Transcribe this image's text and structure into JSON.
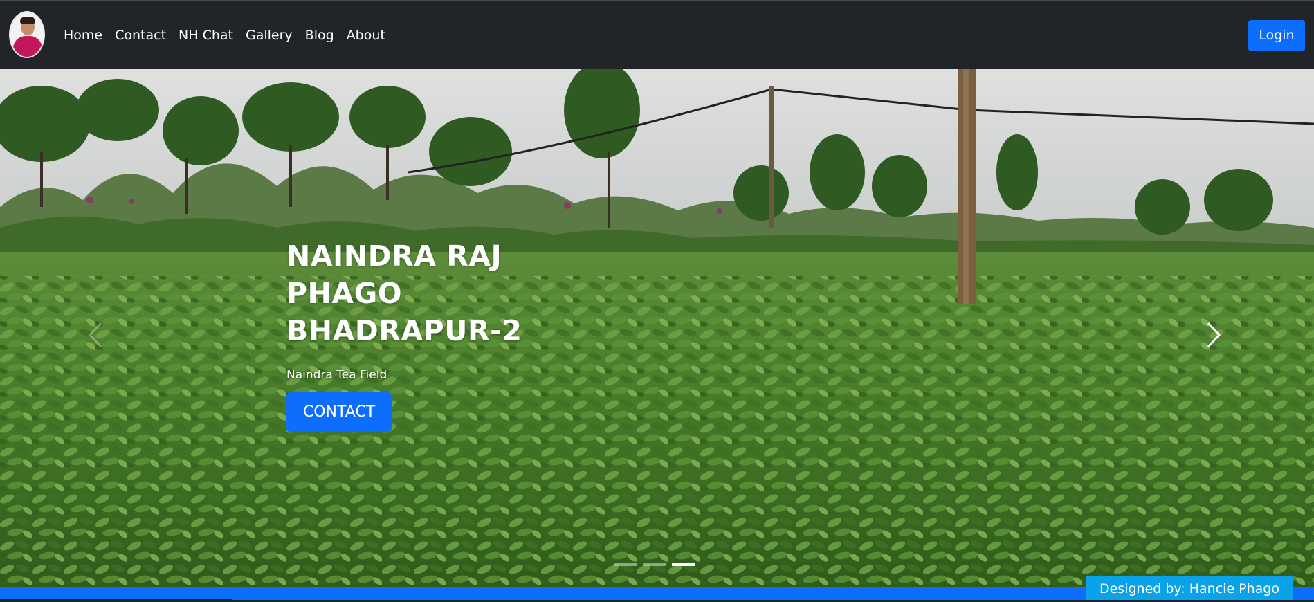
{
  "navbar": {
    "avatar_alt": "profile photo",
    "links": [
      {
        "label": "Home"
      },
      {
        "label": "Contact"
      },
      {
        "label": "NH Chat"
      },
      {
        "label": "Gallery"
      },
      {
        "label": "Blog"
      },
      {
        "label": "About"
      }
    ],
    "login_label": "Login"
  },
  "hero": {
    "title_lines": [
      "NAINDRA RAJ",
      "PHAGO",
      "BHADRAPUR-2"
    ],
    "subtitle": "Naindra Tea Field",
    "cta_label": "CONTACT",
    "prev_icon": "chevron-left-icon",
    "next_icon": "chevron-right-icon",
    "slides_total": 3,
    "active_slide": 3
  },
  "footer": {
    "credit": "Designed by: Hancie Phago"
  },
  "colors": {
    "navbar_bg": "#212529",
    "primary": "#0d6efd",
    "credit_bg": "#0aa2e8"
  }
}
